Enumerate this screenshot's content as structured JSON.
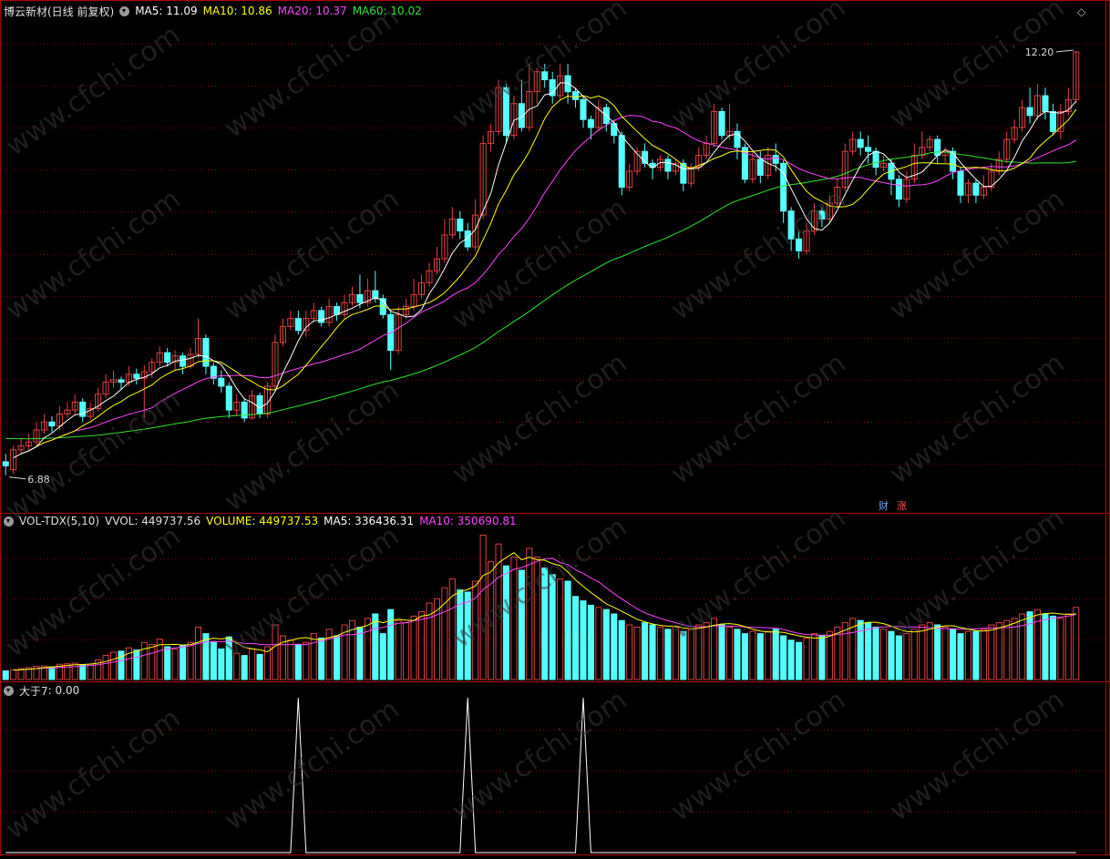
{
  "colors": {
    "up": "#e04040",
    "down": "#54ffff",
    "ma5": "#ffffff",
    "ma10": "#ffff00",
    "ma20": "#ff44ff",
    "ma60": "#2ee62e",
    "grid": "#8a0000",
    "panel_border": "#b00000"
  },
  "header": {
    "title": "博云新材(日线 前复权)",
    "ma5": "MA5: 11.09",
    "ma10": "MA10: 10.86",
    "ma20": "MA20: 10.37",
    "ma60": "MA60: 10.02"
  },
  "volume_header": {
    "name": "VOL-TDX(5,10)",
    "vvol": "VVOL: 449737.56",
    "volume": "VOLUME: 449737.53",
    "ma5": "MA5: 336436.31",
    "ma10": "MA10: 350690.81"
  },
  "indicator_header": {
    "name": "大于7",
    "value": ": 0.00"
  },
  "badges": {
    "cai": "财",
    "zhang": "涨"
  },
  "watermark": "www.cfchi.com",
  "chart_data": [
    {
      "type": "candlestick",
      "title": "博云新材(日线 前复权)",
      "ylim": [
        6.5,
        12.6
      ],
      "annotations": {
        "high": "12.20",
        "low": "6.88"
      },
      "candles": [
        [
          7.05,
          7.0,
          7.15,
          6.88
        ],
        [
          6.95,
          7.2,
          7.25,
          6.9
        ],
        [
          7.2,
          7.25,
          7.35,
          7.15
        ],
        [
          7.25,
          7.3,
          7.4,
          7.2
        ],
        [
          7.3,
          7.45,
          7.55,
          7.25
        ],
        [
          7.45,
          7.55,
          7.65,
          7.4
        ],
        [
          7.55,
          7.5,
          7.62,
          7.42
        ],
        [
          7.5,
          7.65,
          7.75,
          7.45
        ],
        [
          7.65,
          7.7,
          7.8,
          7.6
        ],
        [
          7.7,
          7.8,
          7.9,
          7.65
        ],
        [
          7.8,
          7.62,
          7.85,
          7.55
        ],
        [
          7.62,
          7.72,
          7.8,
          7.58
        ],
        [
          7.72,
          7.9,
          7.98,
          7.68
        ],
        [
          7.9,
          8.05,
          8.15,
          7.85
        ],
        [
          8.05,
          8.08,
          8.2,
          7.98
        ],
        [
          8.08,
          8.05,
          8.12,
          7.95
        ],
        [
          8.05,
          8.15,
          8.25,
          8.0
        ],
        [
          8.15,
          8.1,
          8.22,
          8.02
        ],
        [
          8.1,
          8.18,
          8.26,
          7.6
        ],
        [
          8.18,
          8.3,
          8.35,
          8.1
        ],
        [
          8.3,
          8.42,
          8.5,
          8.25
        ],
        [
          8.42,
          8.3,
          8.48,
          8.25
        ],
        [
          8.3,
          8.38,
          8.45,
          8.2
        ],
        [
          8.38,
          8.25,
          8.42,
          8.15
        ],
        [
          8.25,
          8.4,
          8.48,
          8.22
        ],
        [
          8.4,
          8.6,
          8.85,
          8.35
        ],
        [
          8.6,
          8.25,
          8.65,
          8.15
        ],
        [
          8.25,
          8.1,
          8.3,
          8.02
        ],
        [
          8.1,
          8.0,
          8.2,
          7.92
        ],
        [
          8.0,
          7.7,
          8.05,
          7.6
        ],
        [
          7.7,
          7.8,
          7.9,
          7.62
        ],
        [
          7.8,
          7.6,
          7.85,
          7.55
        ],
        [
          7.6,
          7.88,
          7.95,
          7.58
        ],
        [
          7.88,
          7.65,
          7.92,
          7.6
        ],
        [
          7.65,
          8.0,
          8.05,
          7.6
        ],
        [
          8.0,
          8.55,
          8.65,
          7.95
        ],
        [
          8.55,
          8.75,
          8.85,
          8.5
        ],
        [
          8.75,
          8.85,
          8.95,
          8.7
        ],
        [
          8.85,
          8.7,
          8.95,
          8.65
        ],
        [
          8.7,
          8.85,
          8.95,
          8.62
        ],
        [
          8.85,
          8.95,
          9.05,
          8.8
        ],
        [
          8.95,
          8.8,
          9.0,
          8.75
        ],
        [
          8.8,
          9.0,
          9.1,
          8.75
        ],
        [
          9.0,
          8.9,
          9.05,
          8.82
        ],
        [
          8.9,
          9.05,
          9.15,
          8.85
        ],
        [
          9.05,
          9.15,
          9.25,
          9.0
        ],
        [
          9.15,
          9.05,
          9.4,
          8.98
        ],
        [
          9.05,
          9.2,
          9.35,
          9.0
        ],
        [
          9.2,
          9.1,
          9.45,
          9.05
        ],
        [
          9.1,
          8.9,
          9.15,
          8.85
        ],
        [
          8.9,
          8.45,
          8.95,
          8.2
        ],
        [
          8.45,
          8.9,
          9.0,
          8.4
        ],
        [
          8.9,
          9.0,
          9.1,
          8.85
        ],
        [
          9.0,
          9.15,
          9.35,
          8.95
        ],
        [
          9.15,
          9.3,
          9.4,
          9.1
        ],
        [
          9.3,
          9.45,
          9.55,
          9.25
        ],
        [
          9.45,
          9.6,
          9.75,
          9.4
        ],
        [
          9.6,
          9.9,
          10.1,
          9.55
        ],
        [
          9.9,
          10.1,
          10.25,
          9.85
        ],
        [
          10.1,
          9.95,
          10.2,
          9.85
        ],
        [
          9.95,
          9.75,
          10.05,
          9.7
        ],
        [
          9.75,
          10.15,
          10.35,
          9.7
        ],
        [
          10.15,
          11.05,
          11.15,
          10.1
        ],
        [
          11.05,
          11.2,
          11.3,
          10.95
        ],
        [
          11.2,
          11.75,
          11.85,
          11.15
        ],
        [
          11.75,
          11.15,
          11.8,
          11.05
        ],
        [
          11.15,
          11.55,
          11.65,
          11.1
        ],
        [
          11.55,
          11.25,
          11.85,
          11.2
        ],
        [
          11.25,
          11.7,
          12.05,
          11.2
        ],
        [
          11.7,
          11.95,
          12.0,
          11.55
        ],
        [
          11.95,
          11.85,
          12.05,
          11.75
        ],
        [
          11.85,
          11.65,
          11.95,
          11.55
        ],
        [
          11.65,
          11.9,
          12.05,
          11.6
        ],
        [
          11.9,
          11.7,
          12.05,
          11.55
        ],
        [
          11.7,
          11.6,
          11.75,
          11.5
        ],
        [
          11.6,
          11.35,
          11.65,
          11.25
        ],
        [
          11.35,
          11.25,
          11.4,
          11.1
        ],
        [
          11.25,
          11.5,
          11.6,
          11.2
        ],
        [
          11.5,
          11.3,
          11.55,
          11.2
        ],
        [
          11.3,
          11.15,
          11.35,
          11.05
        ],
        [
          11.15,
          10.5,
          11.2,
          10.4
        ],
        [
          10.5,
          10.7,
          10.8,
          10.45
        ],
        [
          10.7,
          10.95,
          11.0,
          10.65
        ],
        [
          10.95,
          10.8,
          11.05,
          10.75
        ],
        [
          10.8,
          10.75,
          10.85,
          10.6
        ],
        [
          10.75,
          10.85,
          10.9,
          10.7
        ],
        [
          10.85,
          10.7,
          10.9,
          10.6
        ],
        [
          10.7,
          10.8,
          10.85,
          10.65
        ],
        [
          10.8,
          10.55,
          10.85,
          10.45
        ],
        [
          10.55,
          10.75,
          10.8,
          10.5
        ],
        [
          10.75,
          10.9,
          11.0,
          10.7
        ],
        [
          10.9,
          11.05,
          11.15,
          10.85
        ],
        [
          11.05,
          11.45,
          11.55,
          11.0
        ],
        [
          11.45,
          11.15,
          11.5,
          11.1
        ],
        [
          11.15,
          11.2,
          11.55,
          11.1
        ],
        [
          11.2,
          11.0,
          11.3,
          10.85
        ],
        [
          11.0,
          10.6,
          11.05,
          10.55
        ],
        [
          10.6,
          10.85,
          10.95,
          10.55
        ],
        [
          10.85,
          10.65,
          10.95,
          10.55
        ],
        [
          10.65,
          10.9,
          11.0,
          10.6
        ],
        [
          10.9,
          10.8,
          11.05,
          10.7
        ],
        [
          10.8,
          10.2,
          10.85,
          10.05
        ],
        [
          10.2,
          9.85,
          10.25,
          9.7
        ],
        [
          9.85,
          9.7,
          9.95,
          9.6
        ],
        [
          9.7,
          9.95,
          10.05,
          9.65
        ],
        [
          9.95,
          10.2,
          10.3,
          9.9
        ],
        [
          10.2,
          10.1,
          10.25,
          10.0
        ],
        [
          10.1,
          10.3,
          10.4,
          10.05
        ],
        [
          10.3,
          10.5,
          10.6,
          10.25
        ],
        [
          10.5,
          10.95,
          11.05,
          10.45
        ],
        [
          10.95,
          11.1,
          11.2,
          10.9
        ],
        [
          11.1,
          11.0,
          11.2,
          10.9
        ],
        [
          11.0,
          10.95,
          11.15,
          10.8
        ],
        [
          10.95,
          10.75,
          11.0,
          10.65
        ],
        [
          10.75,
          10.8,
          10.9,
          10.7
        ],
        [
          10.8,
          10.6,
          10.85,
          10.4
        ],
        [
          10.6,
          10.35,
          10.65,
          10.25
        ],
        [
          10.35,
          10.6,
          10.7,
          10.3
        ],
        [
          10.6,
          10.9,
          11.05,
          10.55
        ],
        [
          10.9,
          11.0,
          11.2,
          10.85
        ],
        [
          11.0,
          11.1,
          11.15,
          10.95
        ],
        [
          11.1,
          10.9,
          11.15,
          10.8
        ],
        [
          10.9,
          10.95,
          11.0,
          10.8
        ],
        [
          10.95,
          10.7,
          11.0,
          10.6
        ],
        [
          10.7,
          10.4,
          10.75,
          10.3
        ],
        [
          10.4,
          10.55,
          10.6,
          10.3
        ],
        [
          10.55,
          10.4,
          10.6,
          10.3
        ],
        [
          10.4,
          10.5,
          10.65,
          10.35
        ],
        [
          10.5,
          10.7,
          10.8,
          10.45
        ],
        [
          10.7,
          10.85,
          10.95,
          10.65
        ],
        [
          10.85,
          11.1,
          11.2,
          10.8
        ],
        [
          11.1,
          11.25,
          11.35,
          11.05
        ],
        [
          11.25,
          11.5,
          11.6,
          11.2
        ],
        [
          11.5,
          11.4,
          11.75,
          11.3
        ],
        [
          11.4,
          11.65,
          11.8,
          11.35
        ],
        [
          11.65,
          11.45,
          11.75,
          11.35
        ],
        [
          11.45,
          11.2,
          11.55,
          11.15
        ],
        [
          11.2,
          11.45,
          11.55,
          11.1
        ],
        [
          11.45,
          11.6,
          11.75,
          11.4
        ],
        [
          11.6,
          12.2,
          12.2,
          11.55
        ]
      ]
    },
    {
      "type": "bar",
      "title": "VOL-TDX(5,10)",
      "ylim": [
        0,
        700000
      ],
      "up_down": "same_as_candles",
      "values": [
        40000,
        45000,
        50000,
        55000,
        60000,
        62000,
        58000,
        70000,
        72000,
        75000,
        68000,
        70000,
        90000,
        110000,
        125000,
        130000,
        145000,
        135000,
        170000,
        160000,
        185000,
        150000,
        140000,
        155000,
        170000,
        240000,
        210000,
        170000,
        140000,
        195000,
        120000,
        110000,
        140000,
        115000,
        150000,
        250000,
        200000,
        180000,
        160000,
        170000,
        210000,
        190000,
        230000,
        200000,
        250000,
        270000,
        240000,
        280000,
        300000,
        210000,
        320000,
        270000,
        260000,
        290000,
        310000,
        350000,
        370000,
        420000,
        460000,
        410000,
        400000,
        450000,
        660000,
        540000,
        620000,
        520000,
        560000,
        500000,
        600000,
        560000,
        510000,
        480000,
        460000,
        450000,
        380000,
        360000,
        340000,
        330000,
        320000,
        300000,
        270000,
        250000,
        240000,
        260000,
        250000,
        240000,
        230000,
        240000,
        220000,
        230000,
        250000,
        260000,
        280000,
        250000,
        240000,
        230000,
        210000,
        220000,
        210000,
        220000,
        230000,
        200000,
        180000,
        170000,
        190000,
        210000,
        200000,
        220000,
        240000,
        260000,
        280000,
        270000,
        260000,
        240000,
        230000,
        220000,
        200000,
        210000,
        230000,
        250000,
        260000,
        250000,
        240000,
        230000,
        210000,
        220000,
        220000,
        230000,
        250000,
        260000,
        270000,
        280000,
        300000,
        310000,
        320000,
        300000,
        290000,
        280000,
        300000,
        330000
      ]
    },
    {
      "type": "line",
      "title": "大于7",
      "ylim": [
        0,
        1
      ],
      "spikes_at_index": [
        38,
        60,
        75
      ],
      "values_note": "0 everywhere except spikes to 1"
    }
  ]
}
